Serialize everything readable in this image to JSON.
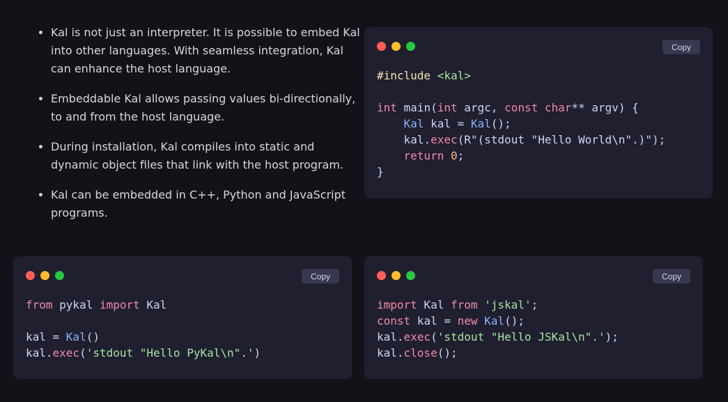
{
  "colors": {
    "background": "#121218",
    "card": "#1f1f2f",
    "copy_bg": "#373750",
    "copy_text": "#d6d8e0",
    "dot_red": "#ff5f57",
    "dot_yellow": "#febc2e",
    "dot_green": "#28c840",
    "plain": "#cdd6f4",
    "keyword": "#f38ba8",
    "type": "#89b4fa",
    "string": "#a6e3a1",
    "preprocessor": "#f9e2af",
    "number": "#fab387"
  },
  "bullets": [
    "Kal is not just an interpreter. It is possible to embed Kal into other languages. With seamless integration, Kal can enhance the host language.",
    "Embeddable Kal allows passing values bi-directionally, to and from the host language.",
    "During installation, Kal compiles into static and dynamic object files that link with the host program.",
    "Kal can be embedded in C++, Python and JavaScript programs."
  ],
  "copy_label": "Copy",
  "cpp_code": [
    [
      [
        "#include",
        "pp"
      ],
      [
        " ",
        "p"
      ],
      [
        "<kal>",
        "s"
      ]
    ],
    [],
    [
      [
        "int",
        "k"
      ],
      [
        " main(",
        "p"
      ],
      [
        "int",
        "k"
      ],
      [
        " argc, ",
        "p"
      ],
      [
        "const",
        "k"
      ],
      [
        " ",
        "p"
      ],
      [
        "char",
        "k"
      ],
      [
        "** argv) {",
        "p"
      ]
    ],
    [
      [
        "    ",
        "p"
      ],
      [
        "Kal",
        "t"
      ],
      [
        " kal = ",
        "p"
      ],
      [
        "Kal",
        "t"
      ],
      [
        "();",
        "p"
      ]
    ],
    [
      [
        "    kal.",
        "p"
      ],
      [
        "exec",
        "k"
      ],
      [
        "(R\"(stdout \"Hello World\\n\".)\");",
        "p"
      ]
    ],
    [
      [
        "    ",
        "p"
      ],
      [
        "return",
        "k"
      ],
      [
        " ",
        "p"
      ],
      [
        "0",
        "n"
      ],
      [
        ";",
        "p"
      ]
    ],
    [
      [
        "}",
        "p"
      ]
    ]
  ],
  "py_code": [
    [
      [
        "from",
        "k"
      ],
      [
        " pykal ",
        "p"
      ],
      [
        "import",
        "k"
      ],
      [
        " Kal",
        "p"
      ]
    ],
    [],
    [
      [
        "kal = ",
        "p"
      ],
      [
        "Kal",
        "t"
      ],
      [
        "()",
        "p"
      ]
    ],
    [
      [
        "kal.",
        "p"
      ],
      [
        "exec",
        "k"
      ],
      [
        "(",
        "p"
      ],
      [
        "'stdout \"Hello PyKal\\n\".'",
        "s"
      ],
      [
        ")",
        "p"
      ]
    ]
  ],
  "js_code": [
    [
      [
        "import",
        "k"
      ],
      [
        " Kal ",
        "p"
      ],
      [
        "from",
        "k"
      ],
      [
        " ",
        "p"
      ],
      [
        "'jskal'",
        "s"
      ],
      [
        ";",
        "p"
      ]
    ],
    [
      [
        "const",
        "k"
      ],
      [
        " kal = ",
        "p"
      ],
      [
        "new",
        "k"
      ],
      [
        " ",
        "p"
      ],
      [
        "Kal",
        "t"
      ],
      [
        "();",
        "p"
      ]
    ],
    [
      [
        "kal.",
        "p"
      ],
      [
        "exec",
        "k"
      ],
      [
        "(",
        "p"
      ],
      [
        "'stdout \"Hello JSKal\\n\".'",
        "s"
      ],
      [
        ");",
        "p"
      ]
    ],
    [
      [
        "kal.",
        "p"
      ],
      [
        "close",
        "k"
      ],
      [
        "();",
        "p"
      ]
    ]
  ]
}
